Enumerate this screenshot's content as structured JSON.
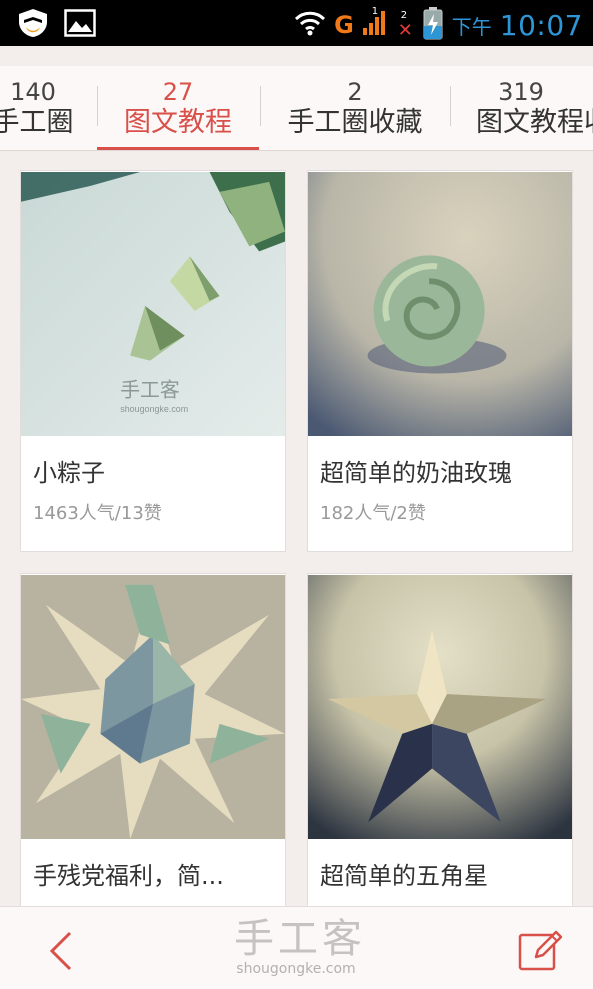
{
  "status_bar": {
    "time": "10:07",
    "am_pm": "下午",
    "network": "G",
    "signal_sub": "1",
    "notification_count": "2"
  },
  "tabs": [
    {
      "count": "140",
      "label": "手工圈",
      "active": false
    },
    {
      "count": "27",
      "label": "图文教程",
      "active": true
    },
    {
      "count": "2",
      "label": "手工圈收藏",
      "active": false
    },
    {
      "count": "319",
      "label": "图文教程收",
      "active": false
    }
  ],
  "cards": [
    {
      "title": "小粽子",
      "meta": "1463人气/13赞",
      "watermark": "手工客",
      "watermark_sub": "shougongke.com"
    },
    {
      "title": "超简单的奶油玫瑰",
      "meta": "182人气/2赞"
    },
    {
      "title": "手残党福利，简...",
      "meta": ""
    },
    {
      "title": "超简单的五角星",
      "meta": ""
    }
  ],
  "bottom_bar": {
    "logo": "手工客",
    "logo_sub": "shougongke.com"
  },
  "colors": {
    "accent": "#d9504a",
    "status_blue": "#2f96d6"
  }
}
